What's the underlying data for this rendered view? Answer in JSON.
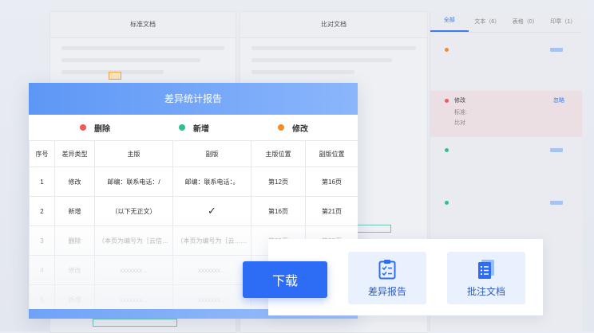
{
  "bg_docs": {
    "standard_label": "标准文档",
    "compare_label": "比对文档"
  },
  "right_panel": {
    "tabs": [
      {
        "label": "全部"
      },
      {
        "label": "文本（6）"
      },
      {
        "label": "表格（0）"
      },
      {
        "label": "印章（1）"
      }
    ],
    "item_label": "修改",
    "item_sub1": "标准:",
    "item_sub2": "比对",
    "item_link": "忽略"
  },
  "report": {
    "title": "差异统计报告",
    "legend": [
      {
        "label": "删除",
        "color": "#f05a5a"
      },
      {
        "label": "新增",
        "color": "#2cc38a"
      },
      {
        "label": "修改",
        "color": "#f28c2c"
      }
    ],
    "columns": [
      "序号",
      "差异类型",
      "主版",
      "副版",
      "主版位置",
      "副版位置"
    ],
    "rows": [
      [
        "1",
        "修改",
        "邮编：联系电话：/",
        "邮编：联系电话：。",
        "第12页",
        "第16页"
      ],
      [
        "2",
        "新增",
        "（以下无正文）",
        "✓",
        "第16页",
        "第21页"
      ],
      [
        "3",
        "删除",
        "（本页为编号为［云信……",
        "（本页为编号为［云……",
        "第22页",
        "第22页"
      ],
      [
        "4",
        "修改",
        "xxxxxxx...",
        "xxxxxxx...",
        "",
        ""
      ],
      [
        "5",
        "新增",
        "xxxxxxx...",
        "xxxxxxx...",
        "",
        ""
      ]
    ]
  },
  "actions": {
    "download_label": "下载",
    "report_label": "差异报告",
    "annotate_label": "批注文档"
  },
  "colors": {
    "primary": "#2d6df5",
    "accent_light": "#eaf1fe"
  }
}
